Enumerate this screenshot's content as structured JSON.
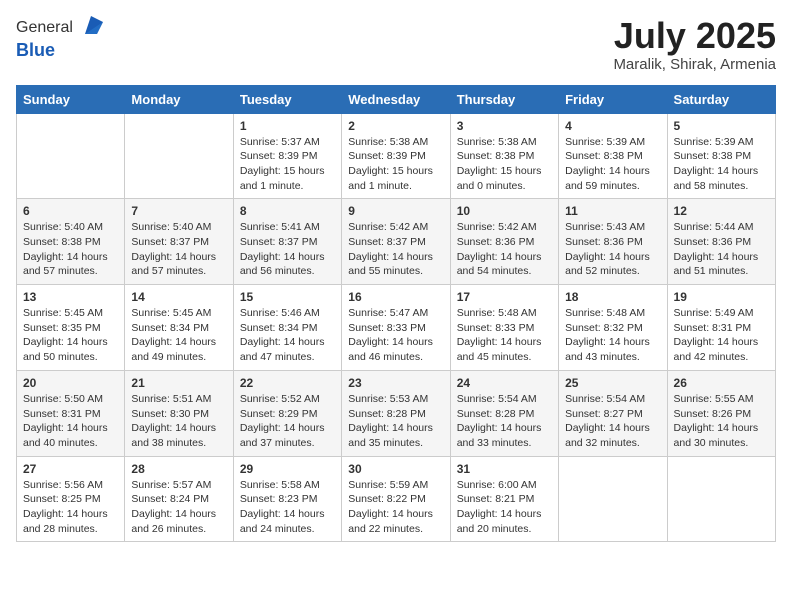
{
  "logo": {
    "general": "General",
    "blue": "Blue"
  },
  "title": {
    "month_year": "July 2025",
    "location": "Maralik, Shirak, Armenia"
  },
  "weekdays": [
    "Sunday",
    "Monday",
    "Tuesday",
    "Wednesday",
    "Thursday",
    "Friday",
    "Saturday"
  ],
  "weeks": [
    [
      {
        "day": null
      },
      {
        "day": null
      },
      {
        "day": "1",
        "sunrise": "5:37 AM",
        "sunset": "8:39 PM",
        "daylight": "15 hours and 1 minute."
      },
      {
        "day": "2",
        "sunrise": "5:38 AM",
        "sunset": "8:39 PM",
        "daylight": "15 hours and 1 minute."
      },
      {
        "day": "3",
        "sunrise": "5:38 AM",
        "sunset": "8:38 PM",
        "daylight": "15 hours and 0 minutes."
      },
      {
        "day": "4",
        "sunrise": "5:39 AM",
        "sunset": "8:38 PM",
        "daylight": "14 hours and 59 minutes."
      },
      {
        "day": "5",
        "sunrise": "5:39 AM",
        "sunset": "8:38 PM",
        "daylight": "14 hours and 58 minutes."
      }
    ],
    [
      {
        "day": "6",
        "sunrise": "5:40 AM",
        "sunset": "8:38 PM",
        "daylight": "14 hours and 57 minutes."
      },
      {
        "day": "7",
        "sunrise": "5:40 AM",
        "sunset": "8:37 PM",
        "daylight": "14 hours and 57 minutes."
      },
      {
        "day": "8",
        "sunrise": "5:41 AM",
        "sunset": "8:37 PM",
        "daylight": "14 hours and 56 minutes."
      },
      {
        "day": "9",
        "sunrise": "5:42 AM",
        "sunset": "8:37 PM",
        "daylight": "14 hours and 55 minutes."
      },
      {
        "day": "10",
        "sunrise": "5:42 AM",
        "sunset": "8:36 PM",
        "daylight": "14 hours and 54 minutes."
      },
      {
        "day": "11",
        "sunrise": "5:43 AM",
        "sunset": "8:36 PM",
        "daylight": "14 hours and 52 minutes."
      },
      {
        "day": "12",
        "sunrise": "5:44 AM",
        "sunset": "8:36 PM",
        "daylight": "14 hours and 51 minutes."
      }
    ],
    [
      {
        "day": "13",
        "sunrise": "5:45 AM",
        "sunset": "8:35 PM",
        "daylight": "14 hours and 50 minutes."
      },
      {
        "day": "14",
        "sunrise": "5:45 AM",
        "sunset": "8:34 PM",
        "daylight": "14 hours and 49 minutes."
      },
      {
        "day": "15",
        "sunrise": "5:46 AM",
        "sunset": "8:34 PM",
        "daylight": "14 hours and 47 minutes."
      },
      {
        "day": "16",
        "sunrise": "5:47 AM",
        "sunset": "8:33 PM",
        "daylight": "14 hours and 46 minutes."
      },
      {
        "day": "17",
        "sunrise": "5:48 AM",
        "sunset": "8:33 PM",
        "daylight": "14 hours and 45 minutes."
      },
      {
        "day": "18",
        "sunrise": "5:48 AM",
        "sunset": "8:32 PM",
        "daylight": "14 hours and 43 minutes."
      },
      {
        "day": "19",
        "sunrise": "5:49 AM",
        "sunset": "8:31 PM",
        "daylight": "14 hours and 42 minutes."
      }
    ],
    [
      {
        "day": "20",
        "sunrise": "5:50 AM",
        "sunset": "8:31 PM",
        "daylight": "14 hours and 40 minutes."
      },
      {
        "day": "21",
        "sunrise": "5:51 AM",
        "sunset": "8:30 PM",
        "daylight": "14 hours and 38 minutes."
      },
      {
        "day": "22",
        "sunrise": "5:52 AM",
        "sunset": "8:29 PM",
        "daylight": "14 hours and 37 minutes."
      },
      {
        "day": "23",
        "sunrise": "5:53 AM",
        "sunset": "8:28 PM",
        "daylight": "14 hours and 35 minutes."
      },
      {
        "day": "24",
        "sunrise": "5:54 AM",
        "sunset": "8:28 PM",
        "daylight": "14 hours and 33 minutes."
      },
      {
        "day": "25",
        "sunrise": "5:54 AM",
        "sunset": "8:27 PM",
        "daylight": "14 hours and 32 minutes."
      },
      {
        "day": "26",
        "sunrise": "5:55 AM",
        "sunset": "8:26 PM",
        "daylight": "14 hours and 30 minutes."
      }
    ],
    [
      {
        "day": "27",
        "sunrise": "5:56 AM",
        "sunset": "8:25 PM",
        "daylight": "14 hours and 28 minutes."
      },
      {
        "day": "28",
        "sunrise": "5:57 AM",
        "sunset": "8:24 PM",
        "daylight": "14 hours and 26 minutes."
      },
      {
        "day": "29",
        "sunrise": "5:58 AM",
        "sunset": "8:23 PM",
        "daylight": "14 hours and 24 minutes."
      },
      {
        "day": "30",
        "sunrise": "5:59 AM",
        "sunset": "8:22 PM",
        "daylight": "14 hours and 22 minutes."
      },
      {
        "day": "31",
        "sunrise": "6:00 AM",
        "sunset": "8:21 PM",
        "daylight": "14 hours and 20 minutes."
      },
      {
        "day": null
      },
      {
        "day": null
      }
    ]
  ],
  "labels": {
    "sunrise": "Sunrise:",
    "sunset": "Sunset:",
    "daylight": "Daylight:"
  }
}
